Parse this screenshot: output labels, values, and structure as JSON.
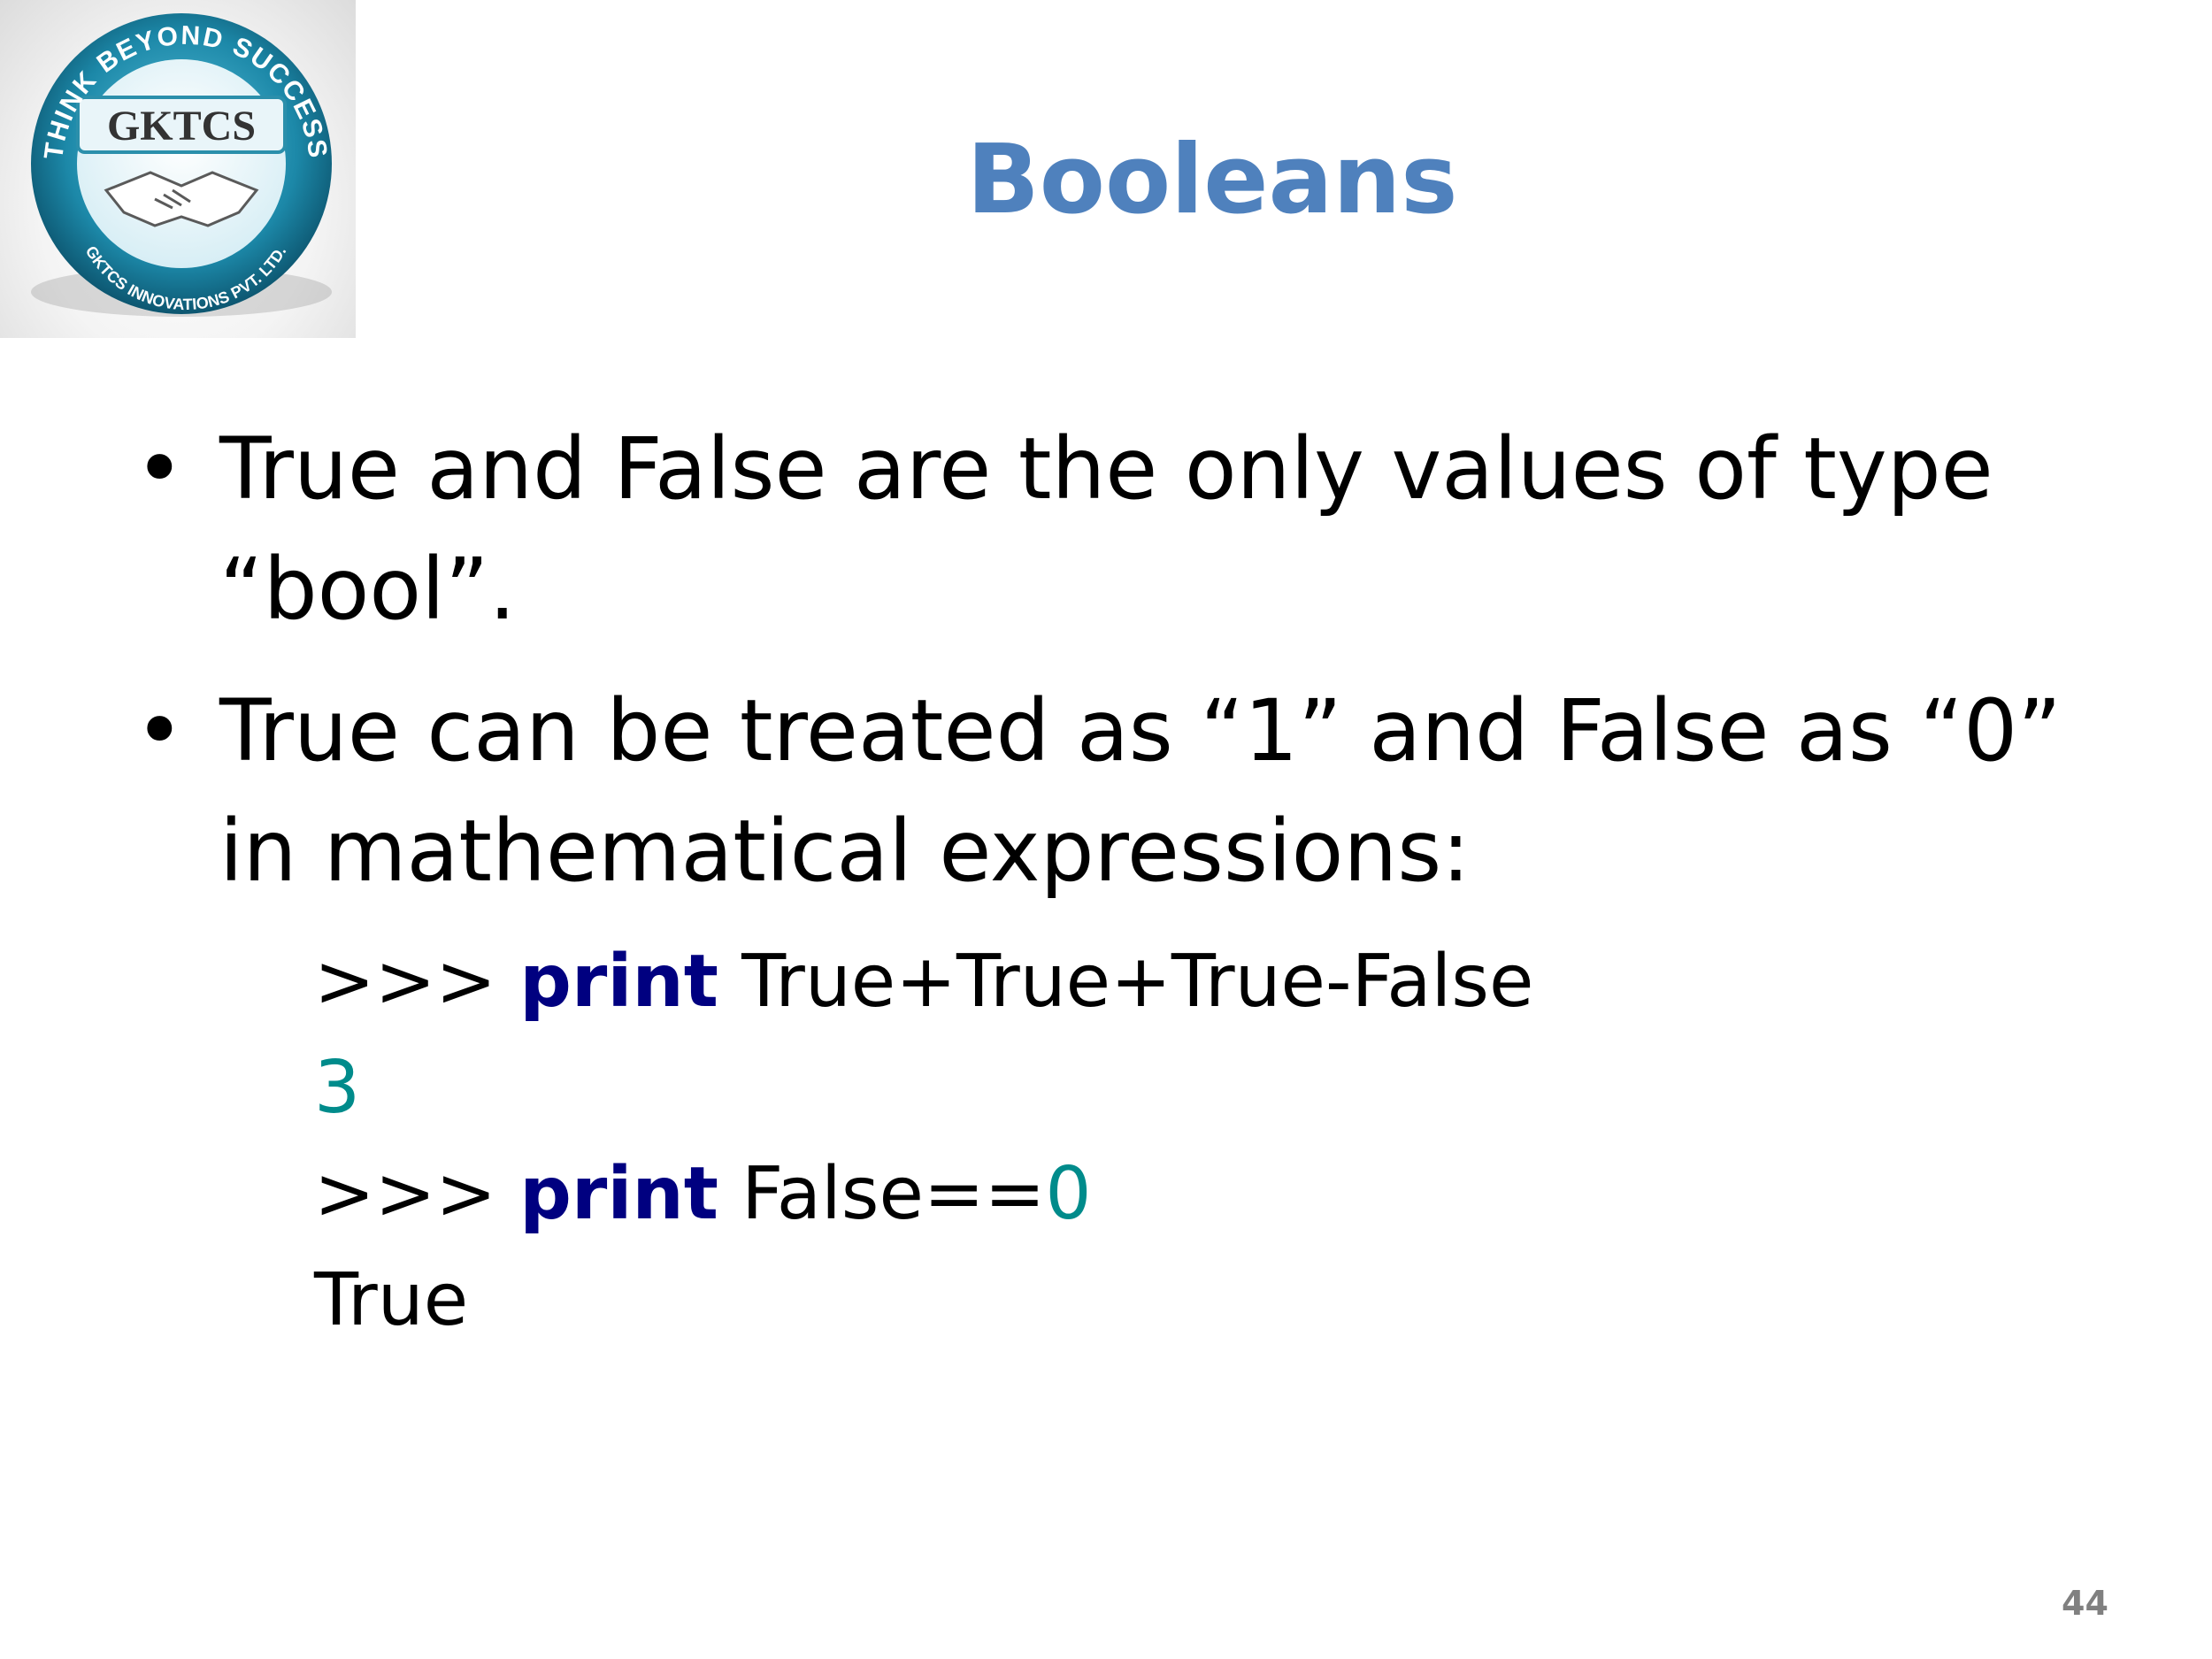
{
  "logo": {
    "ring_text_top": "THINK BEYOND SUCCESS",
    "center_text": "GKTCS",
    "ring_text_bottom": "GKTCS INNOVATIONS PVT. LTD.",
    "icon": "handshake-icon",
    "color": "#1d7e9c"
  },
  "title": "Booleans",
  "bullets": [
    {
      "glyph": "•",
      "text": "True and False are the only values of type “bool”."
    },
    {
      "glyph": "•",
      "text": "True can be treated as “1” and False as “0” in mathematical expressions:"
    }
  ],
  "code": {
    "line1": {
      "prompt": ">>> ",
      "keyword": "print",
      "rest": " True+True+True-False"
    },
    "line2": {
      "output": "3"
    },
    "line3": {
      "prompt": ">>> ",
      "keyword": "print",
      "rest": " False==",
      "number": "0"
    },
    "line4": {
      "output": "True"
    }
  },
  "page_number": "44",
  "colors": {
    "title": "#4f81bd",
    "keyword": "#000080",
    "number": "#008b8b",
    "page_number": "#808080"
  }
}
